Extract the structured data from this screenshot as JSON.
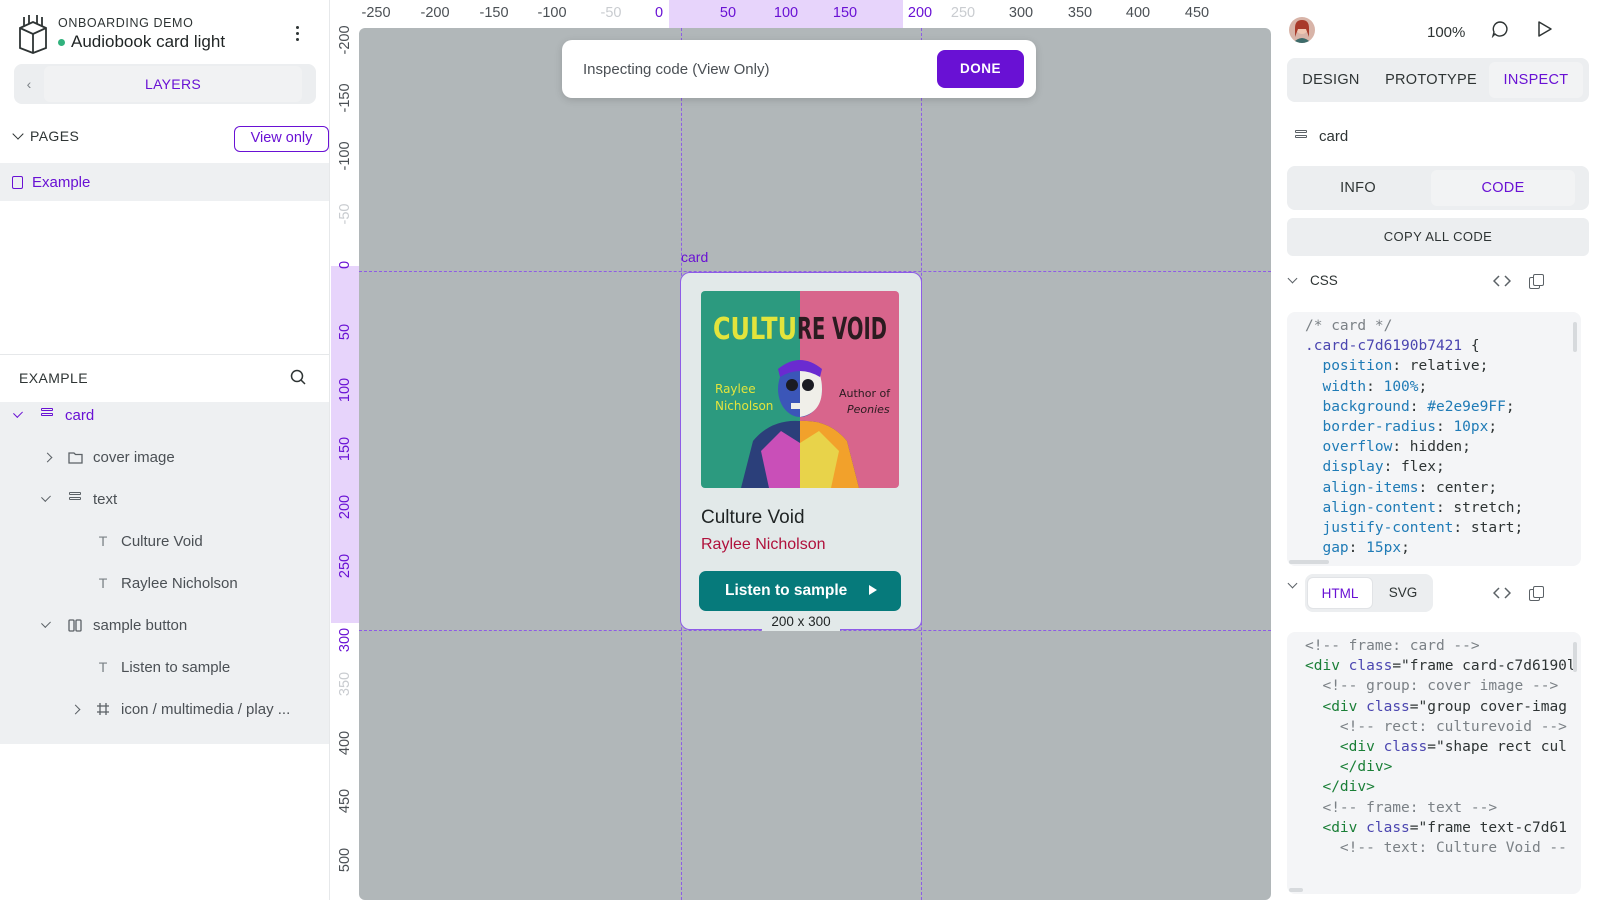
{
  "project": {
    "team": "ONBOARDING DEMO",
    "file_name": "Audiobook card light",
    "status_color": "#31b27d"
  },
  "left": {
    "layers_label": "LAYERS",
    "pages_title": "PAGES",
    "view_only_label": "View only",
    "pages": [
      "Example"
    ],
    "section_title": "EXAMPLE",
    "tree": [
      {
        "label": "card",
        "icon": "board-icon"
      },
      {
        "label": "cover image",
        "icon": "folder-icon"
      },
      {
        "label": "text",
        "icon": "board-icon"
      },
      {
        "label": "Culture Void",
        "icon": "text-icon"
      },
      {
        "label": "Raylee Nicholson",
        "icon": "text-icon"
      },
      {
        "label": "sample button",
        "icon": "columns-icon"
      },
      {
        "label": "Listen to sample",
        "icon": "text-icon"
      },
      {
        "label": "icon / multimedia / play ...",
        "icon": "frame-icon"
      }
    ]
  },
  "rulers": {
    "h": [
      "-250",
      "-200",
      "-150",
      "-100",
      "-50",
      "0",
      "50",
      "100",
      "150",
      "200",
      "250",
      "300",
      "350",
      "400",
      "450"
    ],
    "v": [
      "-200",
      "-150",
      "-100",
      "-50",
      "0",
      "50",
      "100",
      "150",
      "200",
      "250",
      "300",
      "350",
      "400",
      "450",
      "500"
    ]
  },
  "canvas": {
    "banner_text": "Inspecting code (View Only)",
    "done_label": "DONE",
    "frame_label": "card",
    "size_label": "200 x 300",
    "card": {
      "cover_title": "CULTURE VOID",
      "cover_author": "Raylee\nNicholson",
      "cover_tagline_1": "Author of",
      "cover_tagline_2": "Peonies",
      "title": "Culture Void",
      "author": "Raylee Nicholson",
      "button_label": "Listen to sample",
      "bg_color": "#e2e9e9",
      "button_color": "#067a7b",
      "author_color": "#b0113c"
    }
  },
  "right": {
    "zoom": "100%",
    "tabs": [
      "DESIGN",
      "PROTOTYPE",
      "INSPECT"
    ],
    "active_tab": "INSPECT",
    "selection_name": "card",
    "sub_tabs": [
      "INFO",
      "CODE"
    ],
    "active_sub_tab": "CODE",
    "copy_all_label": "COPY ALL CODE",
    "css_label": "CSS",
    "html_tabs": [
      "HTML",
      "SVG"
    ],
    "active_html_tab": "HTML",
    "accent_color": "#6911d4"
  }
}
